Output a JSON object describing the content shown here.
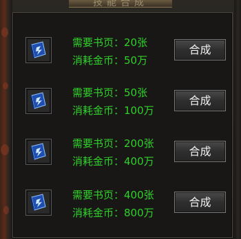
{
  "header": {
    "title": "技能合成"
  },
  "recipes": [
    {
      "pages_label": "需要书页：20张",
      "cost_label": "消耗金币：50万",
      "button_label": "合成",
      "icon": "skill-book-icon"
    },
    {
      "pages_label": "需要书页：50张",
      "cost_label": "消耗金币：100万",
      "button_label": "合成",
      "icon": "skill-book-icon"
    },
    {
      "pages_label": "需要书页：200张",
      "cost_label": "消耗金币：400万",
      "button_label": "合成",
      "icon": "skill-book-icon"
    },
    {
      "pages_label": "需要书页：400张",
      "cost_label": "消耗金币：800万",
      "button_label": "合成",
      "icon": "skill-book-icon"
    }
  ],
  "colors": {
    "text_green": "#2fd12a",
    "panel_bg": "#181715",
    "button_text": "#f2f2f2"
  }
}
